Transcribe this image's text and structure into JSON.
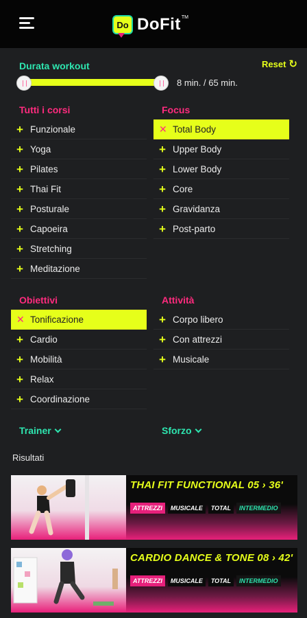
{
  "header": {
    "logo_badge": "Do",
    "logo_text": "DoFit",
    "logo_tm": "TM"
  },
  "duration": {
    "title": "Durata workout",
    "reset_label": "Reset",
    "value_text": "8 min. / 65 min.",
    "min": 8,
    "max": 65
  },
  "corsi": {
    "title": "Tutti i corsi",
    "items": [
      {
        "label": "Funzionale",
        "selected": false
      },
      {
        "label": "Yoga",
        "selected": false
      },
      {
        "label": "Pilates",
        "selected": false
      },
      {
        "label": "Thai Fit",
        "selected": false
      },
      {
        "label": "Posturale",
        "selected": false
      },
      {
        "label": "Capoeira",
        "selected": false
      },
      {
        "label": "Stretching",
        "selected": false
      },
      {
        "label": "Meditazione",
        "selected": false
      }
    ]
  },
  "focus": {
    "title": "Focus",
    "items": [
      {
        "label": "Total Body",
        "selected": true
      },
      {
        "label": "Upper Body",
        "selected": false
      },
      {
        "label": "Lower Body",
        "selected": false
      },
      {
        "label": "Core",
        "selected": false
      },
      {
        "label": "Gravidanza",
        "selected": false
      },
      {
        "label": "Post-parto",
        "selected": false
      }
    ]
  },
  "obiettivi": {
    "title": "Obiettivi",
    "items": [
      {
        "label": "Tonificazione",
        "selected": true
      },
      {
        "label": "Cardio",
        "selected": false
      },
      {
        "label": "Mobilità",
        "selected": false
      },
      {
        "label": "Relax",
        "selected": false
      },
      {
        "label": "Coordinazione",
        "selected": false
      }
    ]
  },
  "attivita": {
    "title": "Attività",
    "items": [
      {
        "label": "Corpo libero",
        "selected": false
      },
      {
        "label": "Con attrezzi",
        "selected": false
      },
      {
        "label": "Musicale",
        "selected": false
      }
    ]
  },
  "dropdowns": {
    "trainer": "Trainer",
    "sforzo": "Sforzo"
  },
  "results": {
    "title": "Risultati",
    "cards": [
      {
        "title": "THAI FIT FUNCTIONAL 05 › 36'",
        "tags": [
          "ATTREZZI",
          "MUSICALE",
          "TOTAL",
          "INTERMEDIO"
        ]
      },
      {
        "title": "CARDIO DANCE & TONE 08 › 42'",
        "tags": [
          "ATTREZZI",
          "MUSICALE",
          "TOTAL",
          "INTERMEDIO"
        ]
      }
    ]
  },
  "colors": {
    "accent_yellow": "#e6ff1a",
    "accent_green": "#2ee6b0",
    "accent_pink": "#ff2b7e",
    "background": "#1e1f21"
  },
  "icons": {
    "menu": "hamburger-icon",
    "reset": "refresh-icon",
    "plus": "plus-icon",
    "remove": "x-icon",
    "dropdown": "chevron-down-icon"
  }
}
